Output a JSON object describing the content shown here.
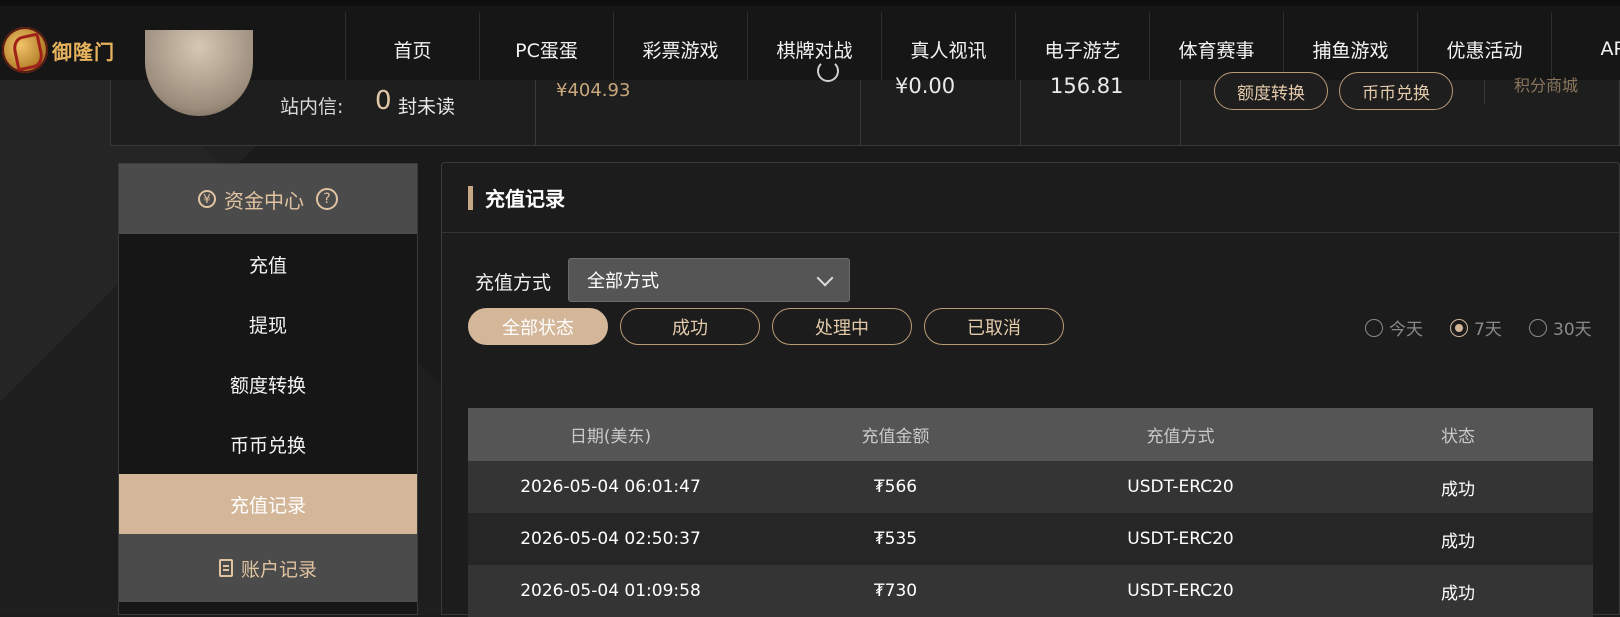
{
  "brand": {
    "name": "御隆门"
  },
  "nav": [
    "首页",
    "PC蛋蛋",
    "彩票游戏",
    "棋牌对战",
    "真人视讯",
    "电子游艺",
    "体育赛事",
    "捕鱼游戏",
    "优惠活动",
    "APP"
  ],
  "summary": {
    "inbox_label": "站内信:",
    "inbox_count": "0",
    "inbox_unread": "封未读",
    "balance_main": "¥404.93",
    "balance_second": "¥0.00",
    "balance_third": "156.81",
    "transfer_label": "额度转换",
    "exchange_label": "币币兑换",
    "cut_text": "积分商城"
  },
  "sidebar": {
    "header": "资金中心",
    "items": [
      {
        "label": "充值",
        "active": false
      },
      {
        "label": "提现",
        "active": false
      },
      {
        "label": "额度转换",
        "active": false
      },
      {
        "label": "币币兑换",
        "active": false
      },
      {
        "label": "充值记录",
        "active": true
      }
    ],
    "sub_header": "账户记录"
  },
  "panel": {
    "title": "充值记录",
    "method_label": "充值方式",
    "method_selected": "全部方式",
    "status_buttons": [
      {
        "label": "全部状态",
        "active": true
      },
      {
        "label": "成功",
        "active": false
      },
      {
        "label": "处理中",
        "active": false
      },
      {
        "label": "已取消",
        "active": false
      }
    ],
    "ranges": [
      {
        "label": "今天",
        "checked": false
      },
      {
        "label": "7天",
        "checked": true
      },
      {
        "label": "30天",
        "checked": false
      }
    ]
  },
  "table": {
    "headers": [
      "日期(美东)",
      "充值金额",
      "充值方式",
      "状态"
    ],
    "rows": [
      [
        "2026-05-04 06:01:47",
        "₮566",
        "USDT-ERC20",
        "成功"
      ],
      [
        "2026-05-04 02:50:37",
        "₮535",
        "USDT-ERC20",
        "成功"
      ],
      [
        "2026-05-04 01:09:58",
        "₮730",
        "USDT-ERC20",
        "成功"
      ]
    ]
  }
}
